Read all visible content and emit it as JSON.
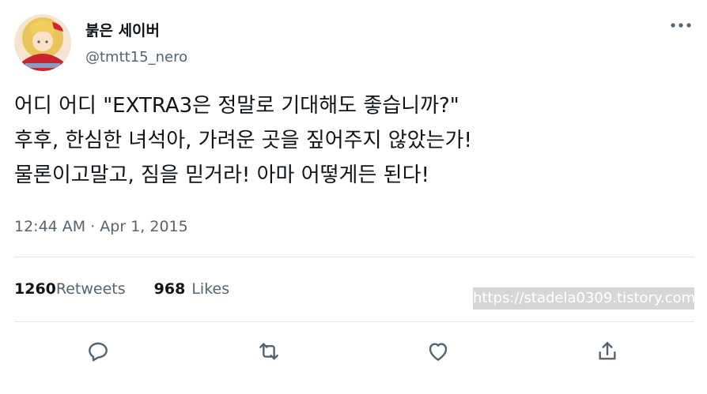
{
  "user": {
    "display_name": "붉은 세이버",
    "handle": "@tmtt15_nero"
  },
  "more_icon": "more-horizontal-icon",
  "tweet": {
    "lines": [
      "어디 어디 \"EXTRA3은 정말로 기대해도 좋습니까?\"",
      "후후, 한심한 녀석아, 가려운 곳을 짚어주지 않았는가!",
      "물론이고말고, 짐을 믿거라! 아마 어떻게든 된다!"
    ],
    "timestamp": "12:44 AM · Apr 1, 2015"
  },
  "stats": {
    "retweets_count": "1260",
    "retweets_label": "Retweets",
    "likes_count": "968",
    "likes_label": "Likes"
  },
  "watermark": "https://stadela0309.tistory.com",
  "actions": [
    "reply-icon",
    "retweet-icon",
    "like-icon",
    "share-icon"
  ],
  "colors": {
    "text": "#0f1419",
    "secondary": "#536471",
    "icon": "#536471",
    "divider": "#e6e9ec"
  }
}
